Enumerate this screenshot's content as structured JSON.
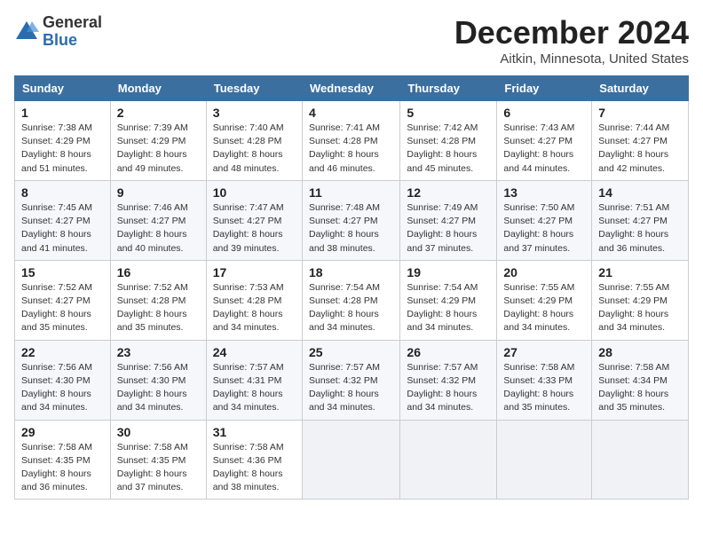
{
  "logo": {
    "general": "General",
    "blue": "Blue"
  },
  "header": {
    "title": "December 2024",
    "subtitle": "Aitkin, Minnesota, United States"
  },
  "weekdays": [
    "Sunday",
    "Monday",
    "Tuesday",
    "Wednesday",
    "Thursday",
    "Friday",
    "Saturday"
  ],
  "weeks": [
    [
      {
        "day": "1",
        "sunrise": "7:38 AM",
        "sunset": "4:29 PM",
        "daylight": "8 hours and 51 minutes."
      },
      {
        "day": "2",
        "sunrise": "7:39 AM",
        "sunset": "4:29 PM",
        "daylight": "8 hours and 49 minutes."
      },
      {
        "day": "3",
        "sunrise": "7:40 AM",
        "sunset": "4:28 PM",
        "daylight": "8 hours and 48 minutes."
      },
      {
        "day": "4",
        "sunrise": "7:41 AM",
        "sunset": "4:28 PM",
        "daylight": "8 hours and 46 minutes."
      },
      {
        "day": "5",
        "sunrise": "7:42 AM",
        "sunset": "4:28 PM",
        "daylight": "8 hours and 45 minutes."
      },
      {
        "day": "6",
        "sunrise": "7:43 AM",
        "sunset": "4:27 PM",
        "daylight": "8 hours and 44 minutes."
      },
      {
        "day": "7",
        "sunrise": "7:44 AM",
        "sunset": "4:27 PM",
        "daylight": "8 hours and 42 minutes."
      }
    ],
    [
      {
        "day": "8",
        "sunrise": "7:45 AM",
        "sunset": "4:27 PM",
        "daylight": "8 hours and 41 minutes."
      },
      {
        "day": "9",
        "sunrise": "7:46 AM",
        "sunset": "4:27 PM",
        "daylight": "8 hours and 40 minutes."
      },
      {
        "day": "10",
        "sunrise": "7:47 AM",
        "sunset": "4:27 PM",
        "daylight": "8 hours and 39 minutes."
      },
      {
        "day": "11",
        "sunrise": "7:48 AM",
        "sunset": "4:27 PM",
        "daylight": "8 hours and 38 minutes."
      },
      {
        "day": "12",
        "sunrise": "7:49 AM",
        "sunset": "4:27 PM",
        "daylight": "8 hours and 37 minutes."
      },
      {
        "day": "13",
        "sunrise": "7:50 AM",
        "sunset": "4:27 PM",
        "daylight": "8 hours and 37 minutes."
      },
      {
        "day": "14",
        "sunrise": "7:51 AM",
        "sunset": "4:27 PM",
        "daylight": "8 hours and 36 minutes."
      }
    ],
    [
      {
        "day": "15",
        "sunrise": "7:52 AM",
        "sunset": "4:27 PM",
        "daylight": "8 hours and 35 minutes."
      },
      {
        "day": "16",
        "sunrise": "7:52 AM",
        "sunset": "4:28 PM",
        "daylight": "8 hours and 35 minutes."
      },
      {
        "day": "17",
        "sunrise": "7:53 AM",
        "sunset": "4:28 PM",
        "daylight": "8 hours and 34 minutes."
      },
      {
        "day": "18",
        "sunrise": "7:54 AM",
        "sunset": "4:28 PM",
        "daylight": "8 hours and 34 minutes."
      },
      {
        "day": "19",
        "sunrise": "7:54 AM",
        "sunset": "4:29 PM",
        "daylight": "8 hours and 34 minutes."
      },
      {
        "day": "20",
        "sunrise": "7:55 AM",
        "sunset": "4:29 PM",
        "daylight": "8 hours and 34 minutes."
      },
      {
        "day": "21",
        "sunrise": "7:55 AM",
        "sunset": "4:29 PM",
        "daylight": "8 hours and 34 minutes."
      }
    ],
    [
      {
        "day": "22",
        "sunrise": "7:56 AM",
        "sunset": "4:30 PM",
        "daylight": "8 hours and 34 minutes."
      },
      {
        "day": "23",
        "sunrise": "7:56 AM",
        "sunset": "4:30 PM",
        "daylight": "8 hours and 34 minutes."
      },
      {
        "day": "24",
        "sunrise": "7:57 AM",
        "sunset": "4:31 PM",
        "daylight": "8 hours and 34 minutes."
      },
      {
        "day": "25",
        "sunrise": "7:57 AM",
        "sunset": "4:32 PM",
        "daylight": "8 hours and 34 minutes."
      },
      {
        "day": "26",
        "sunrise": "7:57 AM",
        "sunset": "4:32 PM",
        "daylight": "8 hours and 34 minutes."
      },
      {
        "day": "27",
        "sunrise": "7:58 AM",
        "sunset": "4:33 PM",
        "daylight": "8 hours and 35 minutes."
      },
      {
        "day": "28",
        "sunrise": "7:58 AM",
        "sunset": "4:34 PM",
        "daylight": "8 hours and 35 minutes."
      }
    ],
    [
      {
        "day": "29",
        "sunrise": "7:58 AM",
        "sunset": "4:35 PM",
        "daylight": "8 hours and 36 minutes."
      },
      {
        "day": "30",
        "sunrise": "7:58 AM",
        "sunset": "4:35 PM",
        "daylight": "8 hours and 37 minutes."
      },
      {
        "day": "31",
        "sunrise": "7:58 AM",
        "sunset": "4:36 PM",
        "daylight": "8 hours and 38 minutes."
      },
      null,
      null,
      null,
      null
    ]
  ],
  "labels": {
    "sunrise": "Sunrise:",
    "sunset": "Sunset:",
    "daylight": "Daylight:"
  }
}
